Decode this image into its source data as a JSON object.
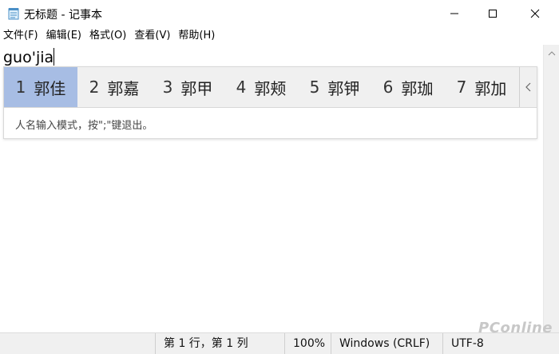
{
  "window": {
    "title": "无标题 - 记事本",
    "icon": "notepad-icon",
    "controls": [
      "minimize-icon",
      "maximize-icon",
      "close-icon"
    ]
  },
  "menu": [
    "文件(F)",
    "编辑(E)",
    "格式(O)",
    "查看(V)",
    "帮助(H)"
  ],
  "editor": {
    "text": "guo'jia"
  },
  "ime": {
    "candidates": [
      {
        "num": "1",
        "text": "郭佳"
      },
      {
        "num": "2",
        "text": "郭嘉"
      },
      {
        "num": "3",
        "text": "郭甲"
      },
      {
        "num": "4",
        "text": "郭颊"
      },
      {
        "num": "5",
        "text": "郭钾"
      },
      {
        "num": "6",
        "text": "郭珈"
      },
      {
        "num": "7",
        "text": "郭加"
      }
    ],
    "hint": "人名输入模式，按\";\"键退出。",
    "selected_color": "#a7bde4"
  },
  "status": {
    "position": "第 1 行，第 1 列",
    "zoom": "100%",
    "line_ending": "Windows (CRLF)",
    "encoding": "UTF-8"
  },
  "watermark": "PConline"
}
